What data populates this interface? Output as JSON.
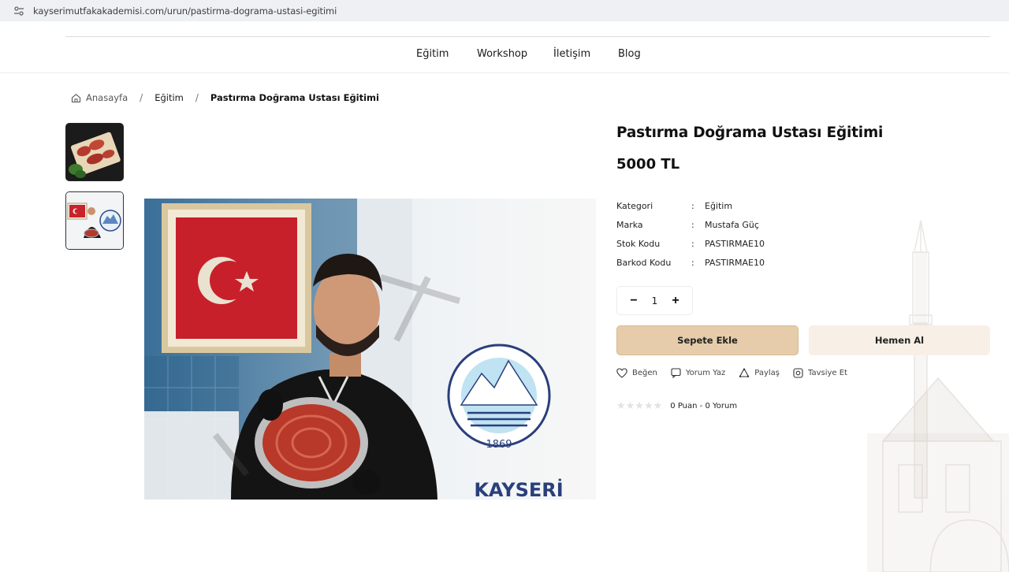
{
  "browser": {
    "url": "kayserimutfakakademisi.com/urun/pastirma-dograma-ustasi-egitimi"
  },
  "nav": {
    "items": [
      "Eğitim",
      "Workshop",
      "İletişim",
      "Blog"
    ]
  },
  "breadcrumb": {
    "home": "Anasayfa",
    "separator": "/",
    "category": "Eğitim",
    "current": "Pastırma Doğrama Ustası Eğitimi"
  },
  "product": {
    "title": "Pastırma Doğrama Ustası Eğitimi",
    "price": "5000 TL",
    "specs": [
      {
        "key": "Kategori",
        "value": "Eğitim"
      },
      {
        "key": "Marka",
        "value": "Mustafa Güç"
      },
      {
        "key": "Stok Kodu",
        "value": "PASTIRMAE10"
      },
      {
        "key": "Barkod Kodu",
        "value": "PASTIRMAE10"
      }
    ],
    "colon": ":",
    "quantity": "1"
  },
  "buttons": {
    "add_to_cart": "Sepete Ekle",
    "buy_now": "Hemen Al",
    "minus": "−",
    "plus": "+"
  },
  "actions": {
    "like": "Beğen",
    "comment": "Yorum Yaz",
    "share": "Paylaş",
    "recommend": "Tavsiye Et"
  },
  "rating": {
    "summary": "0 Puan - 0 Yorum",
    "stars": "★★★★★",
    "score": 0,
    "max": 5
  },
  "image": {
    "banner_text": "KAYSERİ",
    "emblem_top": "KAYSERİ BÜYÜKŞEHİR BELEDİYESİ",
    "emblem_year": "1869"
  },
  "colors": {
    "cart_button": "#e6ccaa",
    "buy_button": "#f8efe6",
    "text": "#1a1a1a"
  }
}
